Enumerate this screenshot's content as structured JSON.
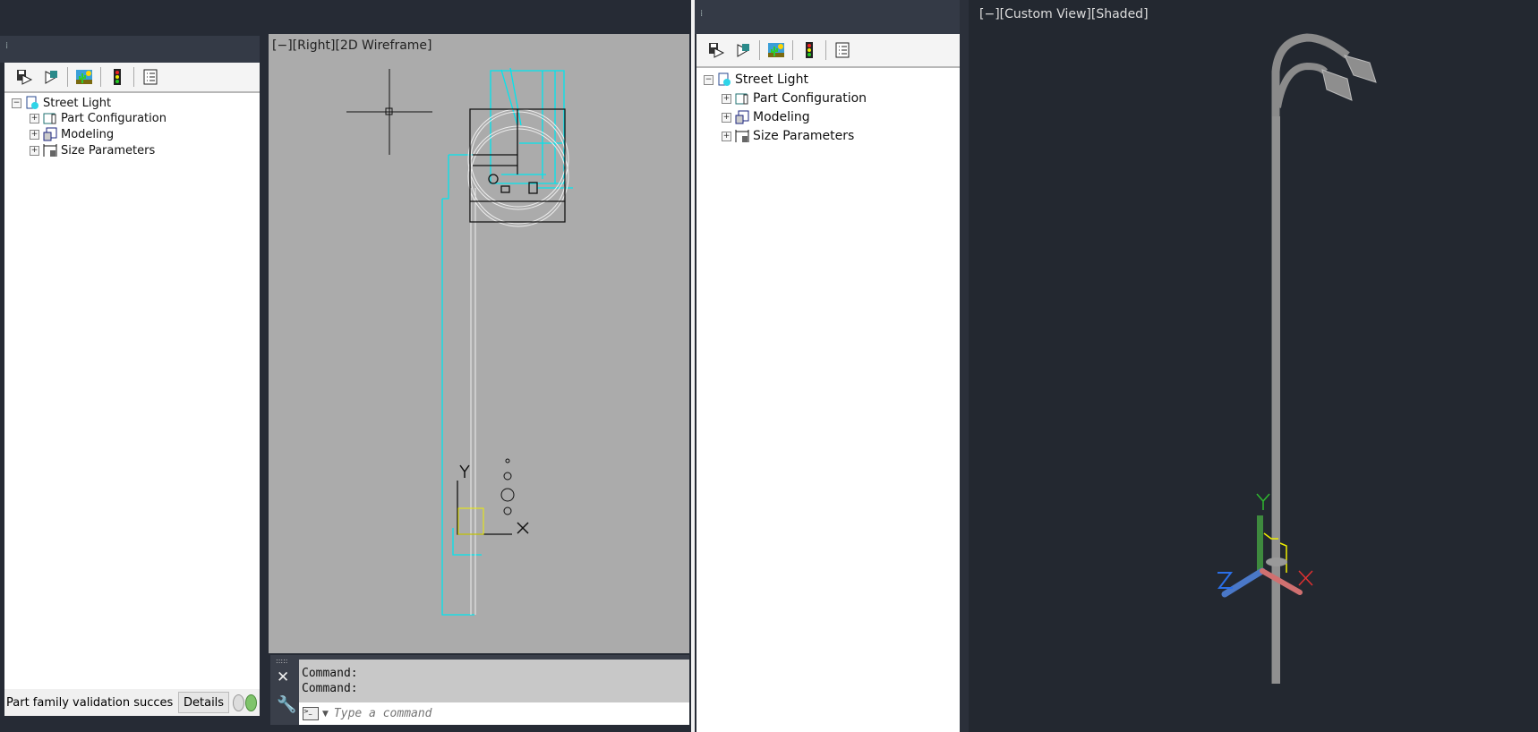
{
  "left_panel": {
    "toolbar_icons": [
      "save-part-icon",
      "save-as-part-icon",
      "part-image-icon",
      "validate-traffic-light-icon",
      "list-icon"
    ],
    "tree": {
      "root": "Street Light",
      "children": [
        "Part Configuration",
        "Modeling",
        "Size Parameters"
      ]
    },
    "status_text": "Part family validation succes",
    "details_label": "Details",
    "status_color": "#7fc46b"
  },
  "viewport_left": {
    "label": "[−][Right][2D Wireframe]",
    "ucs_x": "X",
    "ucs_y": "Y",
    "background": "#ababab"
  },
  "command": {
    "history": [
      "Command:",
      "Command:"
    ],
    "placeholder": "Type a command"
  },
  "right_panel": {
    "toolbar_icons": [
      "save-part-icon",
      "save-as-part-icon",
      "part-image-icon",
      "validate-traffic-light-icon",
      "list-icon"
    ],
    "tree": {
      "root": "Street Light",
      "children": [
        "Part Configuration",
        "Modeling",
        "Size Parameters"
      ]
    }
  },
  "viewport_right": {
    "label": "[−][Custom View][Shaded]",
    "ucs_x": "X",
    "ucs_y": "Y",
    "ucs_z": "Z",
    "background": "#232830"
  }
}
